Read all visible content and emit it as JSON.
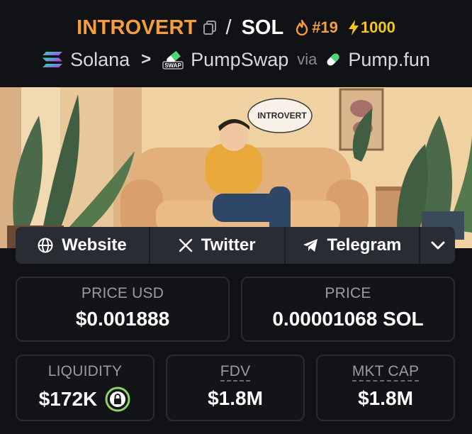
{
  "pair": {
    "base": "INTROVERT",
    "slash": "/",
    "quote": "SOL",
    "rank": "#19",
    "boosts": "1000"
  },
  "path": {
    "chain": "Solana",
    "dex": "PumpSwap",
    "via": "via",
    "launchpad": "Pump.fun"
  },
  "banner": {
    "speech_text": "INTROVERT"
  },
  "links": {
    "website": "Website",
    "twitter": "Twitter",
    "telegram": "Telegram"
  },
  "stats": {
    "price_usd_label": "PRICE USD",
    "price_usd": "$0.001888",
    "price_label": "PRICE",
    "price": "0.00001068 SOL",
    "liquidity_label": "LIQUIDITY",
    "liquidity": "$172K",
    "fdv_label": "FDV",
    "fdv": "$1.8M",
    "mktcap_label": "MKT CAP",
    "mktcap": "$1.8M"
  },
  "colors": {
    "background": "#111216",
    "accent_orange": "#f59e3c",
    "accent_yellow": "#f5c518",
    "card_border": "#2a2c33",
    "liquidity_lock": "#8cd46a"
  }
}
